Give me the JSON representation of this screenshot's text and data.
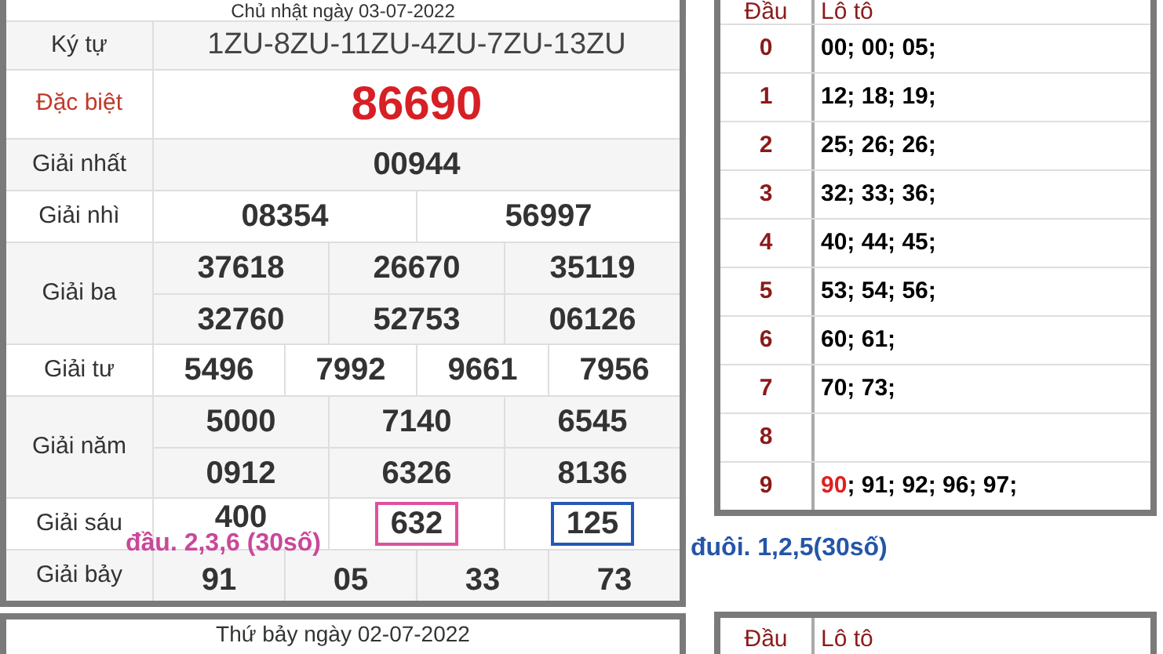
{
  "results": {
    "day_header": "Chủ nhật ngày 03-07-2022",
    "rows": [
      {
        "label": "Ký tự",
        "kind": "code",
        "lines": [
          [
            "1ZU-8ZU-11ZU-4ZU-7ZU-13ZU"
          ]
        ]
      },
      {
        "label": "Đặc biệt",
        "kind": "special",
        "lines": [
          [
            "86690"
          ]
        ]
      },
      {
        "label": "Giải nhất",
        "kind": "prize",
        "lines": [
          [
            "00944"
          ]
        ]
      },
      {
        "label": "Giải nhì",
        "kind": "prize",
        "lines": [
          [
            "08354",
            "56997"
          ]
        ]
      },
      {
        "label": "Giải ba",
        "kind": "prize",
        "lines": [
          [
            "37618",
            "26670",
            "35119"
          ],
          [
            "32760",
            "52753",
            "06126"
          ]
        ]
      },
      {
        "label": "Giải tư",
        "kind": "prize",
        "lines": [
          [
            "5496",
            "7992",
            "9661",
            "7956"
          ]
        ]
      },
      {
        "label": "Giải năm",
        "kind": "prize",
        "lines": [
          [
            "5000",
            "7140",
            "6545"
          ],
          [
            "0912",
            "6326",
            "8136"
          ]
        ]
      },
      {
        "label": "Giải sáu",
        "kind": "prize",
        "lines": [
          [
            "400",
            {
              "text": "632",
              "color": "#e0509e"
            },
            {
              "text": "125",
              "color": "#2458b8"
            }
          ]
        ]
      },
      {
        "label": "Giải bảy",
        "kind": "prize",
        "lines": [
          [
            "91",
            "05",
            "33",
            "73"
          ]
        ]
      }
    ]
  },
  "annotations": [
    {
      "kind": "head",
      "text": "đầu. 2,3,6 (30số)",
      "color": "#c9489a"
    },
    {
      "kind": "tail",
      "text": "đuôi. 1,2,5(30số)",
      "color": "#2456a8"
    }
  ],
  "loto": {
    "header": {
      "head": "Đầu",
      "loto": "Lô tô"
    },
    "rows": [
      {
        "head": "0",
        "parts": [
          {
            "text": "00; 00; 05;",
            "special": false
          }
        ]
      },
      {
        "head": "1",
        "parts": [
          {
            "text": "12; 18; 19;",
            "special": false
          }
        ]
      },
      {
        "head": "2",
        "parts": [
          {
            "text": "25; 26; 26;",
            "special": false
          }
        ]
      },
      {
        "head": "3",
        "parts": [
          {
            "text": "32; 33; 36;",
            "special": false
          }
        ]
      },
      {
        "head": "4",
        "parts": [
          {
            "text": "40; 44; 45;",
            "special": false
          }
        ]
      },
      {
        "head": "5",
        "parts": [
          {
            "text": "53; 54; 56;",
            "special": false
          }
        ]
      },
      {
        "head": "6",
        "parts": [
          {
            "text": "60; 61;",
            "special": false
          }
        ]
      },
      {
        "head": "7",
        "parts": [
          {
            "text": "70; 73;",
            "special": false
          }
        ]
      },
      {
        "head": "8",
        "parts": []
      },
      {
        "head": "9",
        "parts": [
          {
            "text": "90",
            "special": true
          },
          {
            "text": "; 91; 92; 96; 97;",
            "special": false
          }
        ]
      }
    ]
  },
  "next_results": {
    "day_header": "Thứ bảy ngày 02-07-2022"
  },
  "next_loto": {
    "header": {
      "head": "Đầu",
      "loto": "Lô tô"
    }
  }
}
